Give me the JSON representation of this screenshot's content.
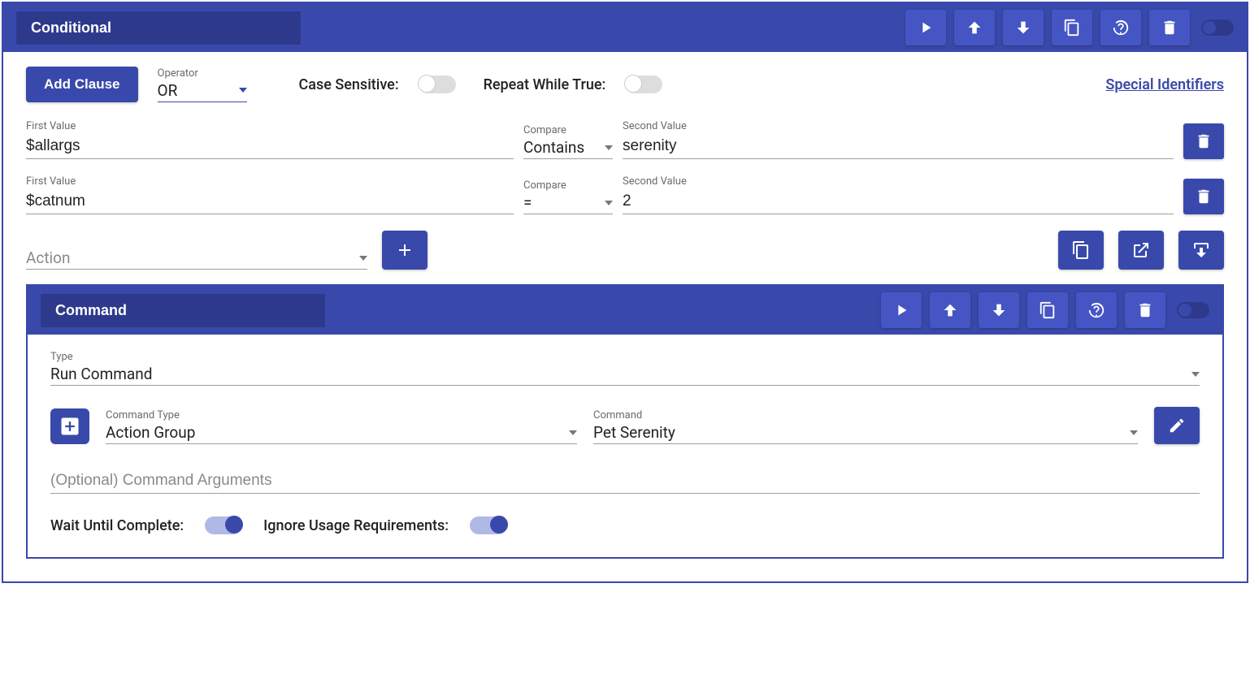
{
  "outer": {
    "title": "Conditional"
  },
  "controls": {
    "addClause": "Add Clause",
    "operatorLabel": "Operator",
    "operatorValue": "OR",
    "caseSensitive": "Case Sensitive:",
    "repeatWhileTrue": "Repeat While True:",
    "specialIdentifiers": "Special Identifiers"
  },
  "clauses": [
    {
      "firstLabel": "First Value",
      "firstValue": "$allargs",
      "compareLabel": "Compare",
      "compareValue": "Contains",
      "secondLabel": "Second Value",
      "secondValue": "serenity"
    },
    {
      "firstLabel": "First Value",
      "firstValue": "$catnum",
      "compareLabel": "Compare",
      "compareValue": "=",
      "secondLabel": "Second Value",
      "secondValue": "2"
    }
  ],
  "actionRow": {
    "placeholder": "Action"
  },
  "nested": {
    "title": "Command",
    "typeLabel": "Type",
    "typeValue": "Run Command",
    "commandTypeLabel": "Command Type",
    "commandTypeValue": "Action Group",
    "commandLabel": "Command",
    "commandValue": "Pet Serenity",
    "argsPlaceholder": "(Optional) Command Arguments",
    "waitUntilComplete": "Wait Until Complete:",
    "ignoreUsage": "Ignore Usage Requirements:"
  }
}
